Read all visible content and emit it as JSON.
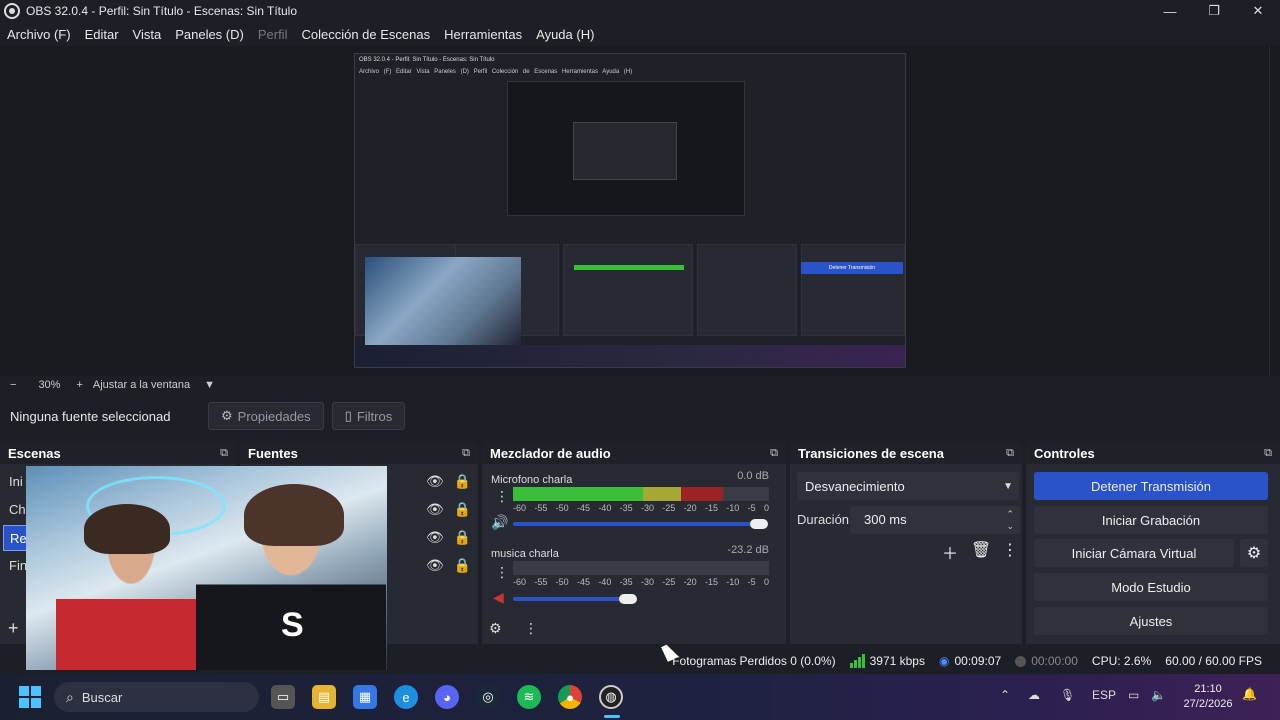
{
  "window": {
    "title": "OBS 32.0.4 - Perfil: Sin Título - Escenas: Sin Título",
    "minimize": "—",
    "maximize": "❐",
    "close": "✕"
  },
  "menu": [
    "Archivo (F)",
    "Editar",
    "Vista",
    "Paneles (D)",
    "Perfil",
    "Colección de Escenas",
    "Herramientas",
    "Ayuda (H)"
  ],
  "preview": {
    "nested_title": "OBS 32.0.4 - Perfil: Sin Título - Escenas: Sin Título",
    "nested_menu": "Archivo (F)  Editar  Vista  Paneles (D)  Perfil  Colección de Escenas  Herramientas  Ayuda (H)",
    "nested_button": "Detener Transmisión"
  },
  "zoom": {
    "minus": "−",
    "value": "30%",
    "plus": "+",
    "fit": "Ajustar a la ventana",
    "caret": "▼"
  },
  "source_bar": {
    "no_selection": "Ninguna fuente seleccionad",
    "properties": "Propiedades",
    "filters": "Filtros"
  },
  "scenes": {
    "title": "Escenas",
    "items": [
      "Ini",
      "Ch",
      "Re",
      "Fin"
    ],
    "active_index": 2,
    "add": "+"
  },
  "sources": {
    "title": "Fuentes"
  },
  "mixer": {
    "title": "Mezclador de audio",
    "channels": [
      {
        "name": "Microfono charla",
        "db": "0.0 dB",
        "level": 0.82,
        "volume": 0.96
      },
      {
        "name": "musica charla",
        "db": "-23.2 dB",
        "level": 0.0,
        "volume": 0.45
      }
    ],
    "ticks": [
      "-60",
      "-55",
      "-50",
      "-45",
      "-40",
      "-35",
      "-30",
      "-25",
      "-20",
      "-15",
      "-10",
      "-5",
      "0"
    ]
  },
  "transitions": {
    "title": "Transiciones de escena",
    "selected": "Desvanecimiento",
    "duration_label": "Duración",
    "duration_value": "300 ms"
  },
  "controls": {
    "title": "Controles",
    "buttons": [
      "Detener Transmisión",
      "Iniciar Grabación",
      "Iniciar Cámara Virtual",
      "Modo Estudio",
      "Ajustes"
    ]
  },
  "status": {
    "dropped": "Fotogramas Perdidos 0 (0.0%)",
    "bitrate": "3971 kbps",
    "stream_time": "00:09:07",
    "rec_time": "00:00:00",
    "cpu": "CPU: 2.6%",
    "fps": "60.00 / 60.00 FPS"
  },
  "taskbar": {
    "search": "Buscar",
    "lang": "ESP",
    "time": "21:10",
    "date": "27/2/2026"
  },
  "colors": {
    "accent": "#2a53c9",
    "dock_bg": "#272a33",
    "window_bg": "#1d1f26"
  }
}
